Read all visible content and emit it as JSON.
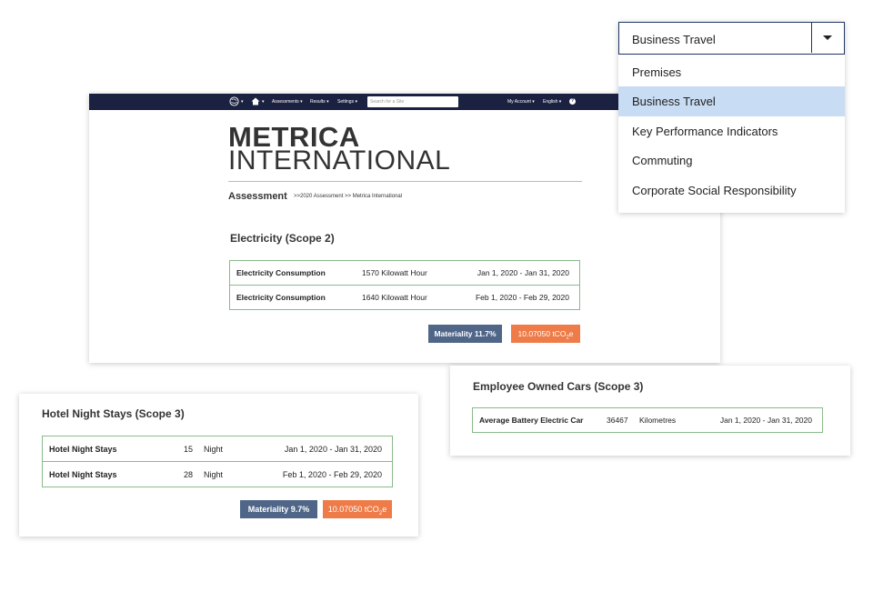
{
  "nav": {
    "assessments": "Assessments",
    "results": "Results",
    "settings": "Settings",
    "search_placeholder": "Search for a Site",
    "my_account": "My Account",
    "language": "English",
    "help": "?"
  },
  "brand": {
    "line1": "METRICA",
    "line2": "INTERNATIONAL"
  },
  "assessment": {
    "title": "Assessment",
    "breadcrumb": ">>2020 Assessment >> Metrica International"
  },
  "electricity": {
    "title": "Electricity (Scope 2)",
    "rows": [
      {
        "name": "Electricity Consumption",
        "qty": "1570 Kilowatt Hour",
        "dates": "Jan 1, 2020 - Jan 31, 2020"
      },
      {
        "name": "Electricity Consumption",
        "qty": "1640 Kilowatt Hour",
        "dates": "Feb 1, 2020 - Feb 29, 2020"
      }
    ],
    "materiality": "Materiality 11.7%",
    "tco_value": "10.07050 tCO",
    "tco_sub": "2",
    "tco_suffix": "e"
  },
  "hotel": {
    "title": "Hotel Night Stays (Scope 3)",
    "rows": [
      {
        "name": "Hotel Night Stays",
        "qty": "15",
        "unit": "Night",
        "dates": "Jan 1, 2020 - Jan 31, 2020"
      },
      {
        "name": "Hotel Night Stays",
        "qty": "28",
        "unit": "Night",
        "dates": "Feb 1, 2020 - Feb 29, 2020"
      }
    ],
    "materiality": "Materiality 9.7%",
    "tco_value": "10.07050 tCO",
    "tco_sub": "2",
    "tco_suffix": "e"
  },
  "cars": {
    "title": "Employee Owned Cars (Scope 3)",
    "rows": [
      {
        "name": "Average Battery Electric Car",
        "qty": "36467",
        "unit": "Kilometres",
        "dates": "Jan 1, 2020 - Jan 31, 2020"
      }
    ]
  },
  "dropdown": {
    "selected": "Business Travel",
    "options": [
      "Premises",
      "Business Travel",
      "Key Performance Indicators",
      "Commuting",
      "Corporate Social Responsibility"
    ],
    "highlight_color": "#c8dcf3"
  },
  "colors": {
    "navbar": "#1b2140",
    "materiality": "#4f6688",
    "tco": "#ee7b48",
    "table_border": "#8aba8a"
  }
}
